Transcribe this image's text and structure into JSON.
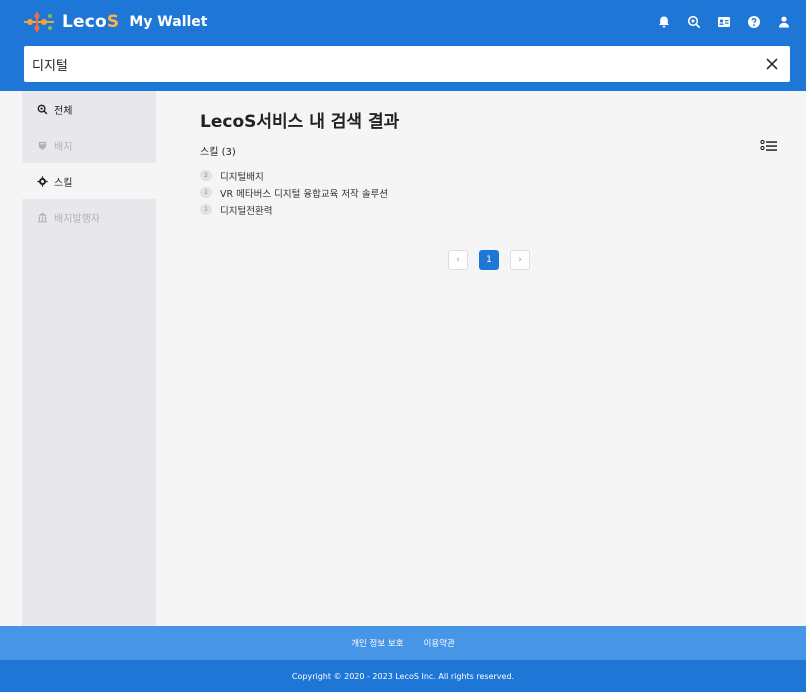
{
  "header": {
    "brand_prefix": "Leco",
    "brand_suffix": "S",
    "title": "My Wallet",
    "icons": [
      "bell-icon",
      "badge-search-icon",
      "id-card-icon",
      "help-icon",
      "user-icon"
    ],
    "accent": "#1e77d6"
  },
  "search": {
    "value": "디지털",
    "clear_icon": "close-icon"
  },
  "sidebar": {
    "items": [
      {
        "label": "전체",
        "icon": "search-icon",
        "state": "dark"
      },
      {
        "label": "배지",
        "icon": "badge-icon",
        "state": "disabled"
      },
      {
        "label": "스킬",
        "icon": "skill-icon",
        "state": "active"
      },
      {
        "label": "배지발행자",
        "icon": "bank-icon",
        "state": "disabled"
      }
    ]
  },
  "main": {
    "title": "LecoS서비스 내 검색 결과",
    "section_label": "스킬",
    "section_count": "(3)",
    "sort_icon": "sort-list-icon",
    "results": [
      {
        "count": "2",
        "label": "디지털배지"
      },
      {
        "count": "1",
        "label": "VR 메타버스 디지털 융합교육 저작 솔루션"
      },
      {
        "count": "1",
        "label": "디지털전환력"
      }
    ],
    "pagination": {
      "prev": "‹",
      "current": "1",
      "next": "›"
    }
  },
  "footer": {
    "links": [
      "개인 정보 보호",
      "이용약관"
    ],
    "copyright": "Copyright © 2020 - 2023 LecoS Inc. All rights reserved."
  }
}
